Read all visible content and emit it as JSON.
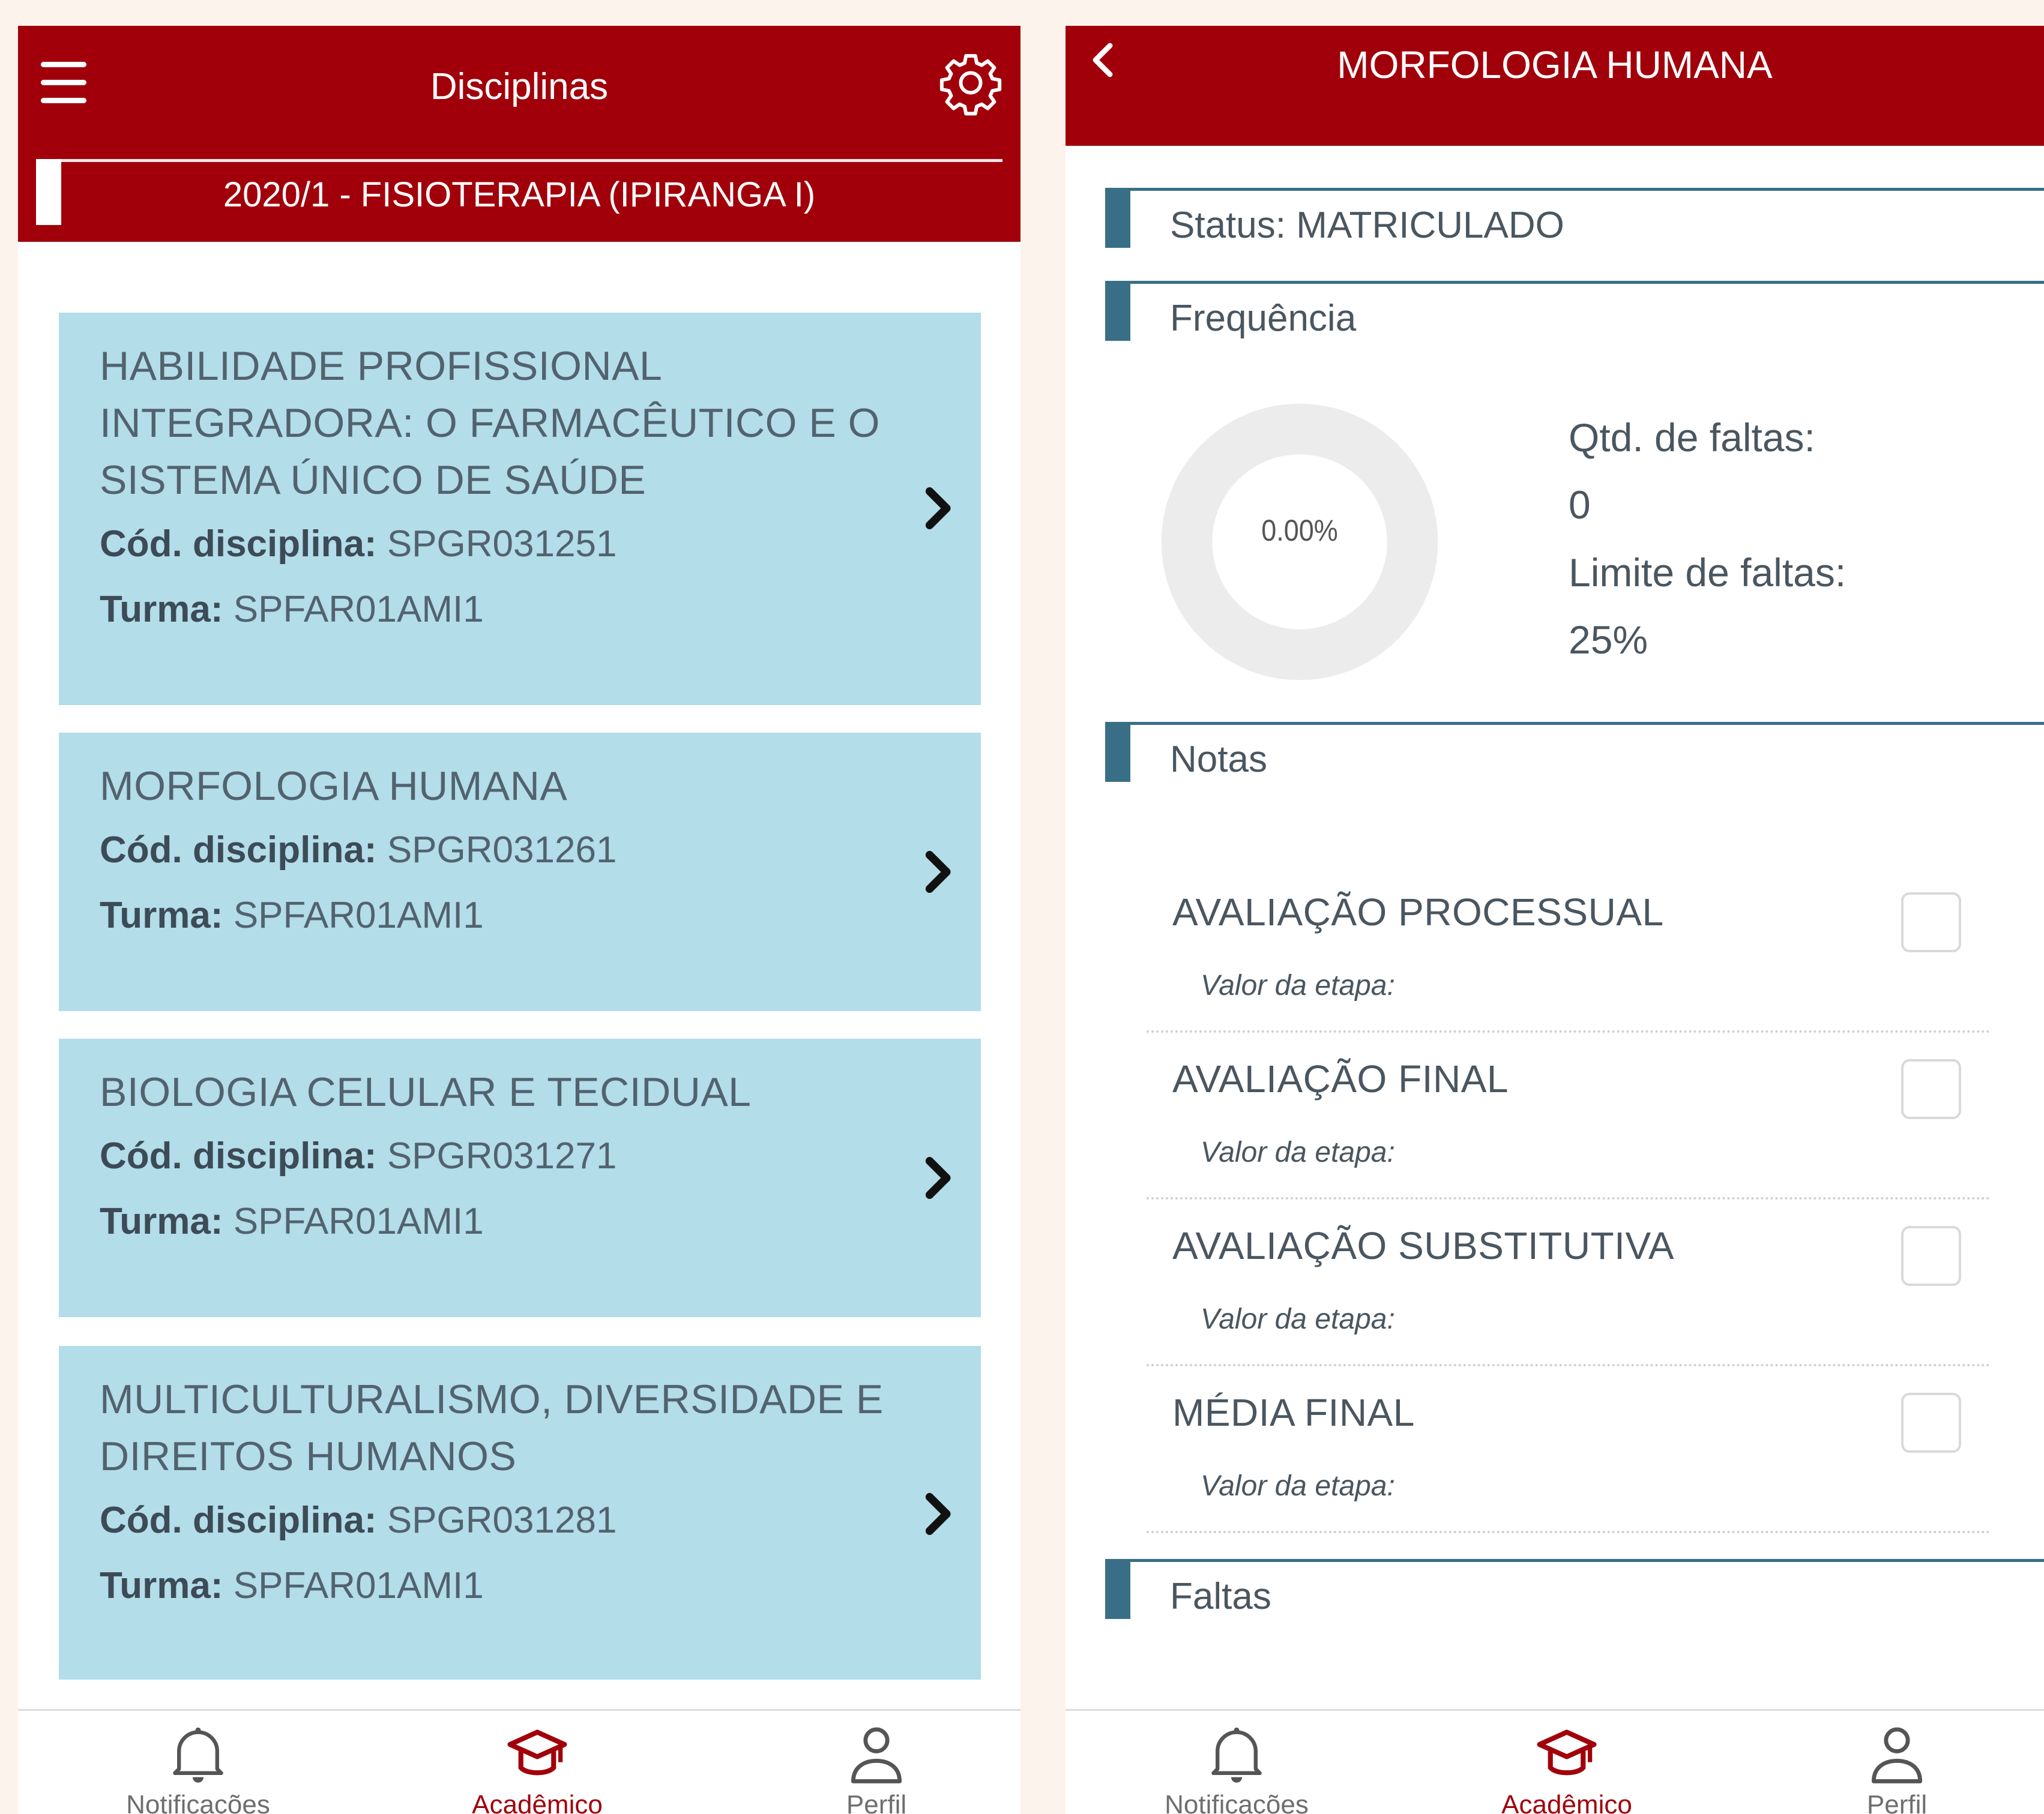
{
  "left_screen": {
    "title": "Disciplinas",
    "course": "2020/1 - FISIOTERAPIA (IPIRANGA I)",
    "code_label": "Cód. disciplina:",
    "class_label": "Turma:",
    "disciplines": [
      {
        "name": "HABILIDADE PROFISSIONAL INTEGRADORA: O FARMACÊUTICO E O SISTEMA ÚNICO DE SAÚDE",
        "code": "SPGR031251",
        "class": "SPFAR01AMI1"
      },
      {
        "name": "MORFOLOGIA HUMANA",
        "code": "SPGR031261",
        "class": "SPFAR01AMI1"
      },
      {
        "name": "BIOLOGIA CELULAR E TECIDUAL",
        "code": "SPGR031271",
        "class": "SPFAR01AMI1"
      },
      {
        "name": "MULTICULTURALISMO, DIVERSIDADE E DIREITOS HUMANOS",
        "code": "SPGR031281",
        "class": "SPFAR01AMI1"
      }
    ]
  },
  "right_screen": {
    "title": "MORFOLOGIA HUMANA",
    "status": "Status: MATRICULADO",
    "frequency_title": "Frequência",
    "frequency_percent": "0.00%",
    "absences_label": "Qtd. de faltas:",
    "absences_value": "0",
    "limit_label": "Limite de faltas:",
    "limit_value": "25%",
    "grades_title": "Notas",
    "grades": [
      {
        "name": "AVALIAÇÃO PROCESSUAL",
        "sub": "Valor da etapa:"
      },
      {
        "name": "AVALIAÇÃO FINAL",
        "sub": "Valor da etapa:"
      },
      {
        "name": "AVALIAÇÃO SUBSTITUTIVA",
        "sub": "Valor da etapa:"
      },
      {
        "name": "MÉDIA FINAL",
        "sub": "Valor da etapa:"
      }
    ],
    "absences_title": "Faltas"
  },
  "bottom_nav": {
    "notifications": "Notificações",
    "academic": "Acadêmico",
    "profile": "Perfil"
  },
  "colors": {
    "brand": "#a1000a",
    "card": "#b2dde9",
    "section_accent": "#386f86",
    "page_background": "#fcf3ec"
  },
  "icons": [
    "menu-icon",
    "gear-icon",
    "chevron-right-icon",
    "back-icon",
    "bell-icon",
    "graduation-cap-icon",
    "user-icon"
  ]
}
